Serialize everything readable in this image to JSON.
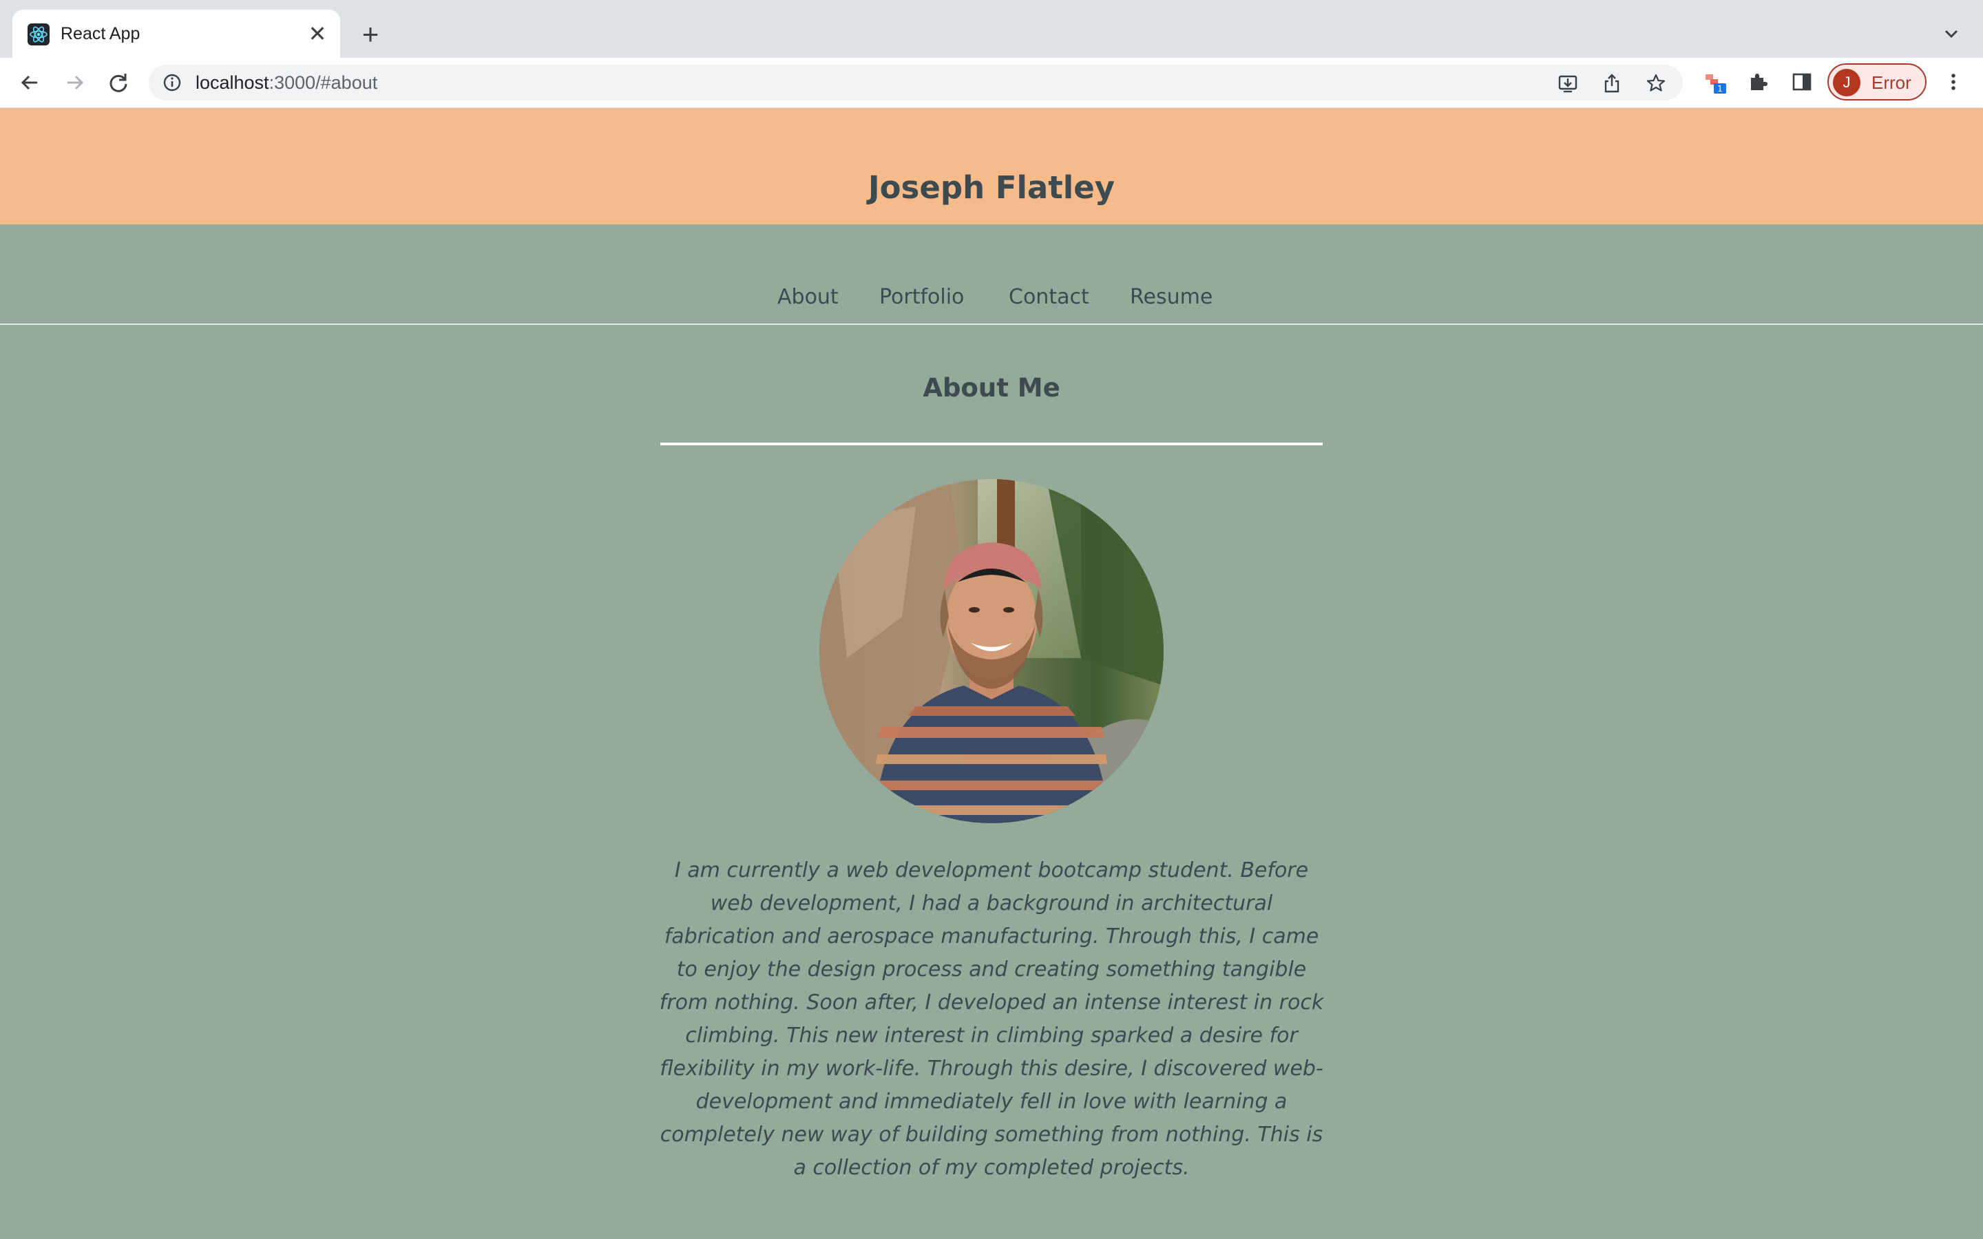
{
  "browser": {
    "tab": {
      "title": "React App",
      "close_glyph": "✕",
      "favicon": "react-icon"
    },
    "new_tab_glyph": "+",
    "address": {
      "host": "localhost",
      "path": ":3000/#about"
    },
    "profile": {
      "initial": "J",
      "label": "Error"
    },
    "extension_badge": "1"
  },
  "site": {
    "title": "Joseph Flatley",
    "nav": [
      "About",
      "Portfolio",
      "Contact",
      "Resume"
    ]
  },
  "about": {
    "heading": "About Me",
    "bio": "I am currently a web development bootcamp student. Before web development, I had a background in architectural fabrication and aerospace manufacturing. Through this, I came to enjoy the design process and creating something tangible from nothing. Soon after, I developed an intense interest in rock climbing. This new interest in climbing sparked a desire for flexibility in my work-life. Through this desire, I discovered web-development and immediately fell in love with learning a completely new way of building something from nothing. This is a collection of my completed projects."
  },
  "colors": {
    "header_bg": "#f5bb8b",
    "page_bg": "#94ab9b",
    "text": "#3d4a4f",
    "profile_accent": "#a8392b"
  }
}
